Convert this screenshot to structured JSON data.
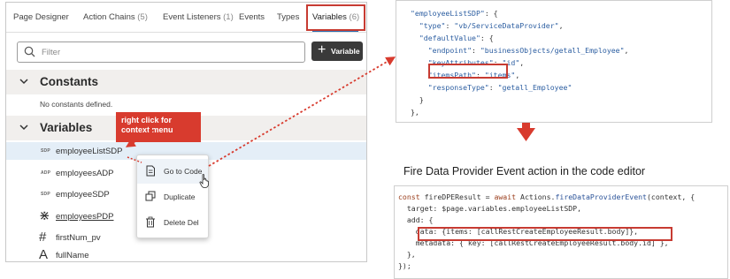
{
  "tabs": [
    {
      "label": "Page Designer",
      "count": ""
    },
    {
      "label": "Action Chains",
      "count": "(5)"
    },
    {
      "label": "Event Listeners",
      "count": "(1)"
    },
    {
      "label": "Events",
      "count": ""
    },
    {
      "label": "Types",
      "count": ""
    },
    {
      "label": "Variables",
      "count": "(6)"
    }
  ],
  "filter": {
    "placeholder": "Filter",
    "icon": "search-icon"
  },
  "add_variable": {
    "plus": "+",
    "label": "Variable"
  },
  "sections": {
    "constants": {
      "title": "Constants",
      "empty": "No constants defined."
    },
    "variables": {
      "title": "Variables"
    }
  },
  "variables": [
    {
      "badge": "SDP",
      "symbol": "",
      "name": "employeeListSDP",
      "selected": true,
      "underline": false
    },
    {
      "badge": "ADP",
      "symbol": "",
      "name": "employeesADP",
      "selected": false,
      "underline": false
    },
    {
      "badge": "SDP",
      "symbol": "",
      "name": "employeeSDP",
      "selected": false,
      "underline": false
    },
    {
      "badge": "",
      "symbol": "⋇",
      "name": "employeesPDP",
      "selected": false,
      "underline": true
    },
    {
      "badge": "",
      "symbol": "#",
      "name": "firstNum_pv",
      "selected": false,
      "underline": false
    },
    {
      "badge": "",
      "symbol": "A",
      "name": "fullName",
      "selected": false,
      "underline": false
    }
  ],
  "callout": {
    "text": "right click for context menu"
  },
  "context_menu": [
    {
      "label": "Go to Code",
      "icon": "document-icon"
    },
    {
      "label": "Duplicate",
      "icon": "duplicate-icon"
    },
    {
      "label": "Delete  Del",
      "icon": "trash-icon"
    }
  ],
  "code_top": [
    [
      [
        "str",
        "\"employeeListSDP\""
      ],
      [
        "pun",
        ": {"
      ]
    ],
    [
      [
        "pun",
        "  "
      ],
      [
        "str",
        "\"type\""
      ],
      [
        "pun",
        ": "
      ],
      [
        "str",
        "\"vb/ServiceDataProvider\""
      ],
      [
        "pun",
        ","
      ]
    ],
    [
      [
        "pun",
        "  "
      ],
      [
        "str",
        "\"defaultValue\""
      ],
      [
        "pun",
        ": {"
      ]
    ],
    [
      [
        "pun",
        "    "
      ],
      [
        "str",
        "\"endpoint\""
      ],
      [
        "pun",
        ": "
      ],
      [
        "str",
        "\"businessObjects/getall_Employee\""
      ],
      [
        "pun",
        ","
      ]
    ],
    [
      [
        "pun",
        "    "
      ],
      [
        "str",
        "\"keyAttributes\""
      ],
      [
        "pun",
        ": "
      ],
      [
        "str",
        "\"id\""
      ],
      [
        "pun",
        ","
      ]
    ],
    [
      [
        "pun",
        "    "
      ],
      [
        "str",
        "\"itemsPath\""
      ],
      [
        "pun",
        ": "
      ],
      [
        "str",
        "\"items\""
      ],
      [
        "pun",
        ","
      ]
    ],
    [
      [
        "pun",
        "    "
      ],
      [
        "str",
        "\"responseType\""
      ],
      [
        "pun",
        ": "
      ],
      [
        "str",
        "\"getall_Employee\""
      ]
    ],
    [
      [
        "pun",
        "  }"
      ]
    ],
    [
      [
        "pun",
        "},"
      ]
    ]
  ],
  "caption": "Fire Data Provider Event action in the code editor",
  "code_bottom": [
    [
      [
        "kw",
        "const "
      ],
      [
        "pun",
        "fireDPEResult = "
      ],
      [
        "kw",
        "await "
      ],
      [
        "pun",
        "Actions."
      ],
      [
        "fn",
        "fireDataProviderEvent"
      ],
      [
        "pun",
        "(context, {"
      ]
    ],
    [
      [
        "pun",
        "  target: $page.variables.employeeListSDP,"
      ]
    ],
    [
      [
        "pun",
        "  add: {"
      ]
    ],
    [
      [
        "pun",
        "    data: {items: [callRestCreateEmployeeResult.body]},"
      ]
    ],
    [
      [
        "pun",
        "    metadata: { key: [callRestCreateEmployeeResult.body.id] },"
      ]
    ],
    [
      [
        "pun",
        "  },"
      ]
    ],
    [
      [
        "pun",
        "});"
      ]
    ]
  ],
  "colors": {
    "accent_red": "#d83b2e",
    "tab_underline": "#2a6bb0",
    "selected_row": "#e4eef7"
  }
}
